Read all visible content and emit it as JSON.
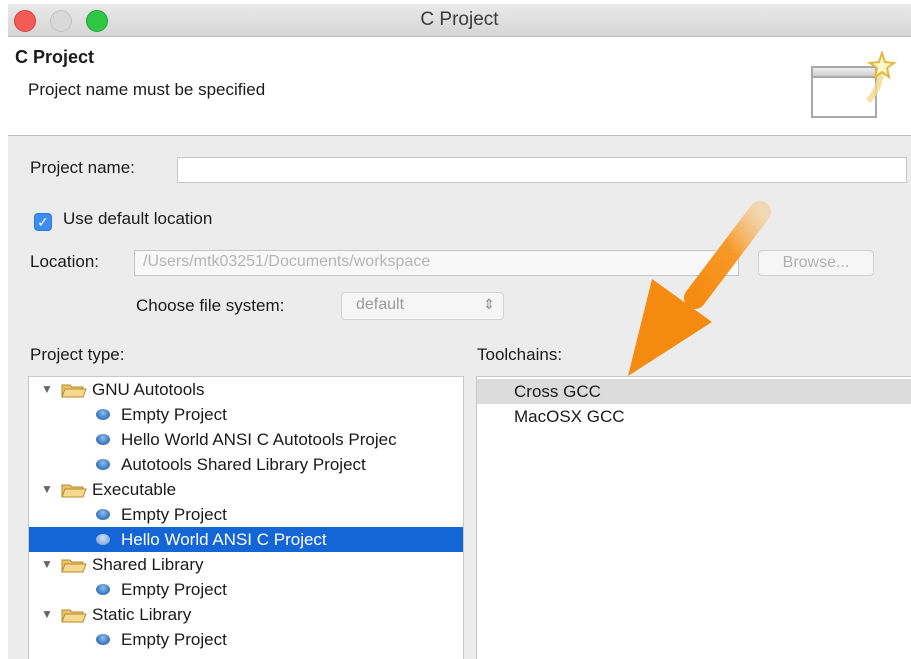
{
  "window": {
    "title": "C Project"
  },
  "banner": {
    "title": "C Project",
    "message": "Project name must be specified"
  },
  "form": {
    "project_name_label": "Project name:",
    "project_name_value": "",
    "use_default_location_label": "Use default location",
    "use_default_location_checked": true,
    "location_label": "Location:",
    "location_value": "/Users/mtk03251/Documents/workspace",
    "browse_label": "Browse...",
    "file_system_label": "Choose file system:",
    "file_system_value": "default"
  },
  "project_type": {
    "label": "Project type:",
    "tree": [
      {
        "type": "category",
        "label": "GNU Autotools"
      },
      {
        "type": "item",
        "label": "Empty Project"
      },
      {
        "type": "item",
        "label": "Hello World ANSI C Autotools Projec"
      },
      {
        "type": "item",
        "label": "Autotools Shared Library Project"
      },
      {
        "type": "category",
        "label": "Executable"
      },
      {
        "type": "item",
        "label": "Empty Project"
      },
      {
        "type": "item",
        "label": "Hello World ANSI C Project",
        "selected": true
      },
      {
        "type": "category",
        "label": "Shared Library"
      },
      {
        "type": "item",
        "label": "Empty Project"
      },
      {
        "type": "category",
        "label": "Static Library"
      },
      {
        "type": "item",
        "label": "Empty Project"
      }
    ]
  },
  "toolchains": {
    "label": "Toolchains:",
    "items": [
      {
        "label": "Cross GCC",
        "highlighted": true
      },
      {
        "label": "MacOSX GCC"
      }
    ]
  },
  "icons": {
    "checkbox": "checkmark-icon",
    "select": "up-down-chevron-icon",
    "wizard": "wizard-banner-icon",
    "annotation": "orange-arrow-icon"
  },
  "colors": {
    "selection": "#1466d6",
    "checkbox": "#3b8ef0",
    "annotation_arrow": "#f7941d",
    "close": "#f25b56",
    "maximize": "#2ec642"
  }
}
